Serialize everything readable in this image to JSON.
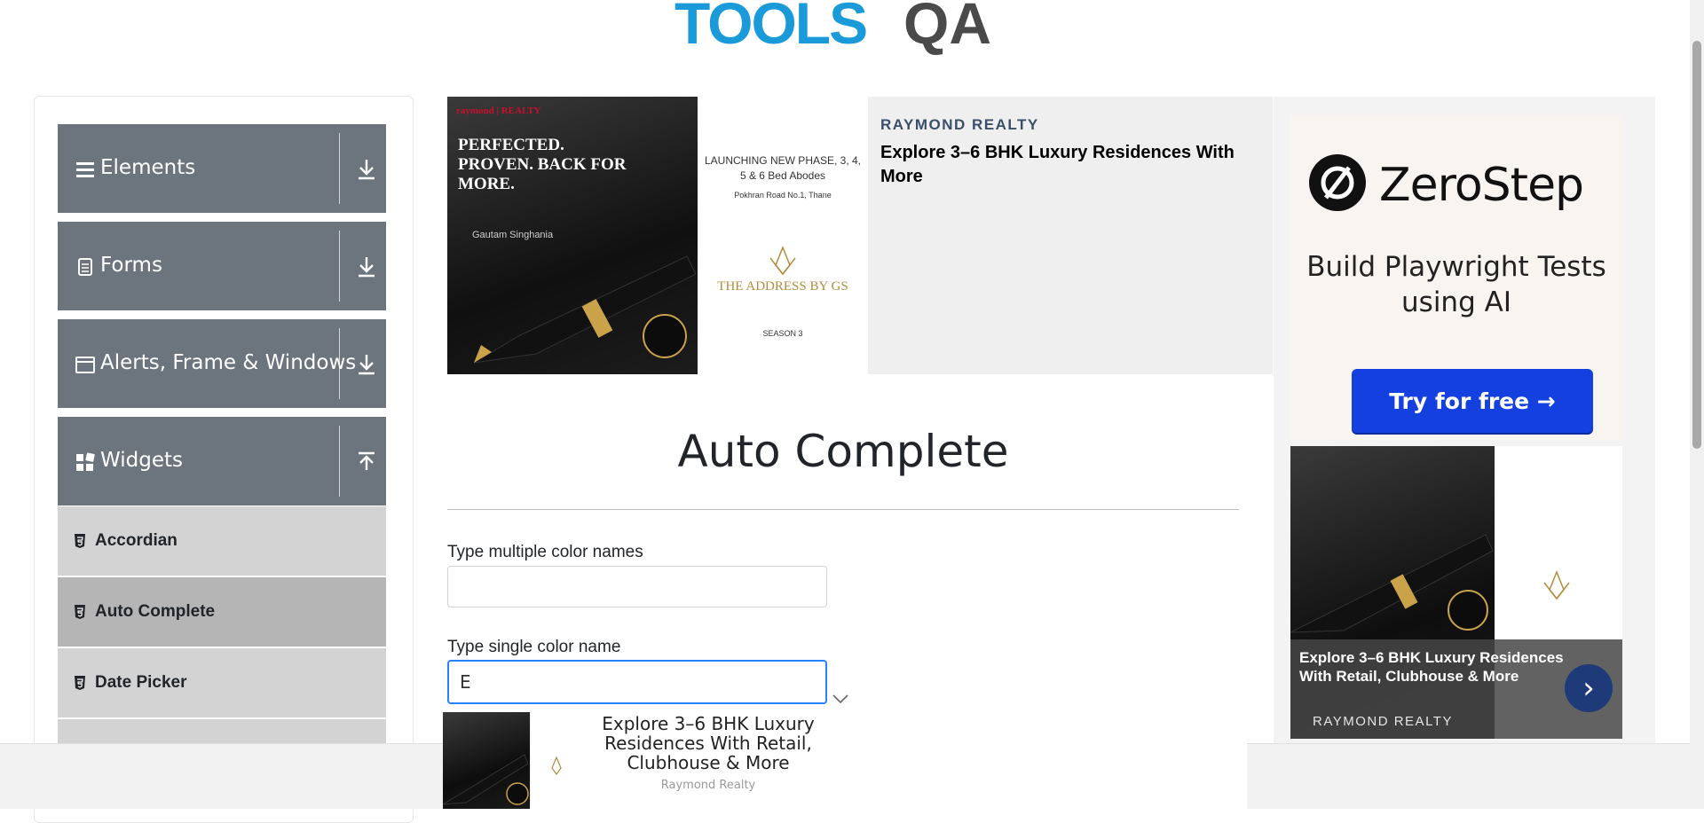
{
  "logo": {
    "part1": "TOOLS",
    "part2": "QA"
  },
  "sidebar": {
    "groups": [
      {
        "label": "Elements",
        "icon": "hamburger-icon",
        "arrow": "download-icon"
      },
      {
        "label": "Forms",
        "icon": "document-icon",
        "arrow": "download-icon"
      },
      {
        "label": "Alerts, Frame & Windows",
        "icon": "window-icon",
        "arrow": "download-icon"
      },
      {
        "label": "Widgets",
        "icon": "widgets-icon",
        "arrow": "upload-icon"
      }
    ],
    "widget_items": [
      {
        "label": "Accordian",
        "active": false
      },
      {
        "label": "Auto Complete",
        "active": true
      },
      {
        "label": "Date Picker",
        "active": false
      }
    ]
  },
  "top_ad": {
    "brand": "raymond | REALTY",
    "headline": "PERFECTED. PROVEN. BACK FOR MORE.",
    "signature": "Gautam Singhania",
    "phase": "LAUNCHING NEW PHASE, 3, 4, 5 & 6 Bed Abodes",
    "location": "Pokhran Road No.1, Thane",
    "project": "THE ADDRESS BY GS",
    "season": "SEASON 3",
    "sponsor": "RAYMOND REALTY",
    "title": "Explore 3–6 BHK Luxury Residences With More"
  },
  "right_ad": {
    "brand": "ZeroStep",
    "tagline": "Build Playwright Tests using AI",
    "cta": "Try for free →",
    "image_title": "Explore 3–6 BHK Luxury Residences With Retail, Clubhouse & More",
    "sponsor": "RAYMOND REALTY",
    "next_icon": "chevron-right-icon"
  },
  "main": {
    "title": "Auto Complete",
    "multi_label": "Type multiple color names",
    "multi_value": "",
    "single_label": "Type single color name",
    "single_value": "E"
  },
  "bottom_ad": {
    "title": "Explore 3–6 BHK Luxury Residences With Retail, Clubhouse & More",
    "sponsor": "Raymond Realty"
  },
  "colors": {
    "sidebar_group": "#6c757d",
    "sidebar_item": "#d3d3d3",
    "sidebar_item_active": "#b5b5b5",
    "focus_border": "#2684ff",
    "cta_blue": "#1440e0",
    "logo_blue": "#1a9ad8"
  }
}
